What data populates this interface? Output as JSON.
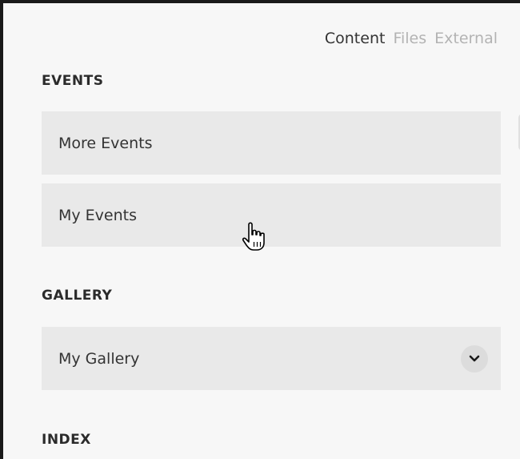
{
  "tabs": [
    {
      "label": "Content",
      "active": true
    },
    {
      "label": "Files",
      "active": false
    },
    {
      "label": "External",
      "active": false
    }
  ],
  "sections": {
    "events": {
      "heading": "EVENTS",
      "items": [
        {
          "label": "More Events"
        },
        {
          "label": "My Events"
        }
      ]
    },
    "gallery": {
      "heading": "GALLERY",
      "items": [
        {
          "label": "My Gallery",
          "expand_icon": "chevron-down-icon"
        }
      ]
    },
    "index": {
      "heading": "INDEX"
    }
  },
  "cursor": {
    "icon": "hand-pointer-icon",
    "hovering": "My Events"
  },
  "colors": {
    "panel_bg": "#f7f7f7",
    "item_bg": "#e9e9e9",
    "text": "#333333",
    "inactive_tab": "#b3b3b3",
    "left_border": "#1a1a1a"
  }
}
